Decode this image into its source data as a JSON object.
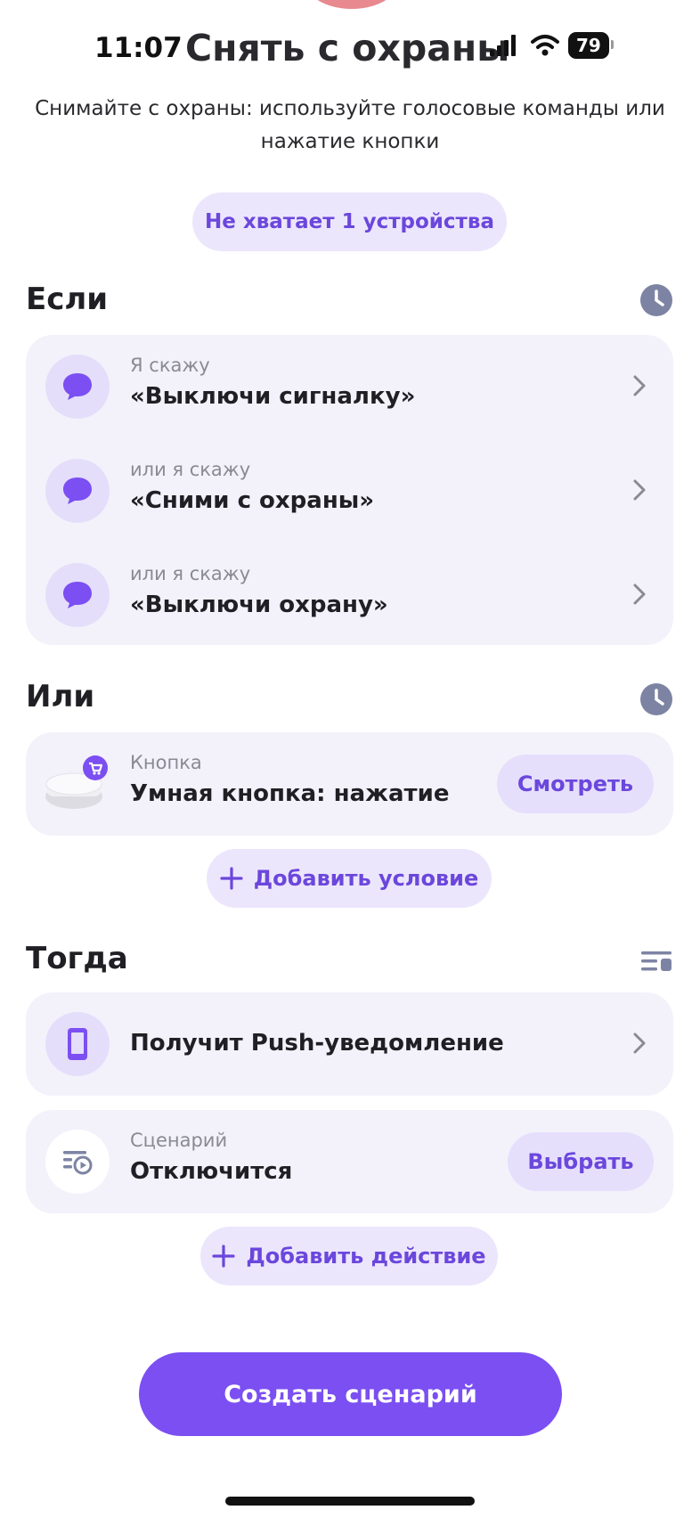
{
  "status": {
    "time": "11:07",
    "battery": "79"
  },
  "header": {
    "title": "Снять с охраны",
    "subtitle_line1": "Снимайте с охраны: используйте голосовые команды или",
    "subtitle_line2": "нажатие кнопки",
    "missing_devices": "Не хватает 1 устройства"
  },
  "if_section": {
    "title": "Если",
    "icon": "clock-icon",
    "items": [
      {
        "caption": "Я скажу",
        "text": "«Выключи сигналку»",
        "icon": "chat-bubble-icon"
      },
      {
        "caption": "или я скажу",
        "text": "«Сними с охраны»",
        "icon": "chat-bubble-icon"
      },
      {
        "caption": "или я скажу",
        "text": "«Выключи охрану»",
        "icon": "chat-bubble-icon"
      }
    ]
  },
  "or_section": {
    "title": "Или",
    "icon": "clock-icon",
    "button_item": {
      "caption": "Кнопка",
      "text": "Умная кнопка: нажатие",
      "action": "Смотреть",
      "icon": "smart-button-device-icon"
    },
    "add_condition": "Добавить условие"
  },
  "then_section": {
    "title": "Тогда",
    "icon": "list-settings-icon",
    "push_item": {
      "text": "Получит Push-уведомление",
      "icon": "phone-icon"
    },
    "scenario_item": {
      "caption": "Сценарий",
      "text": "Отключится",
      "action": "Выбрать",
      "icon": "scenario-icon"
    },
    "add_action": "Добавить действие"
  },
  "footer": {
    "create_button": "Создать сценарий"
  },
  "colors": {
    "accent": "#7b4ff2",
    "accent_text": "#6b47dc",
    "card_bg": "#f3f2fb",
    "chip_bg": "#ece6fd"
  }
}
